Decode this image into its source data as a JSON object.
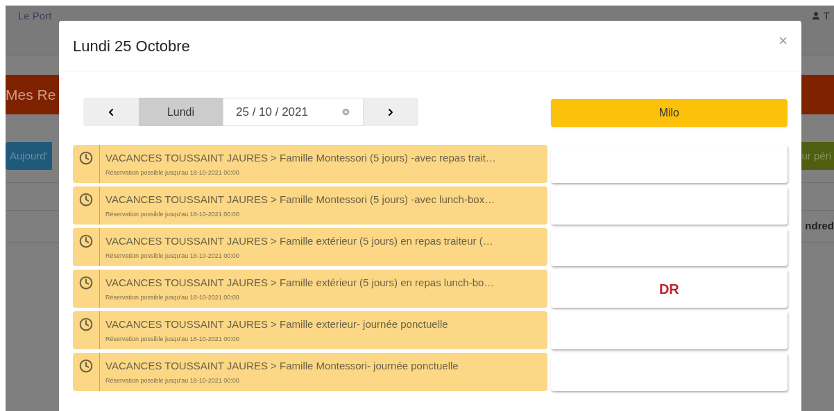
{
  "background": {
    "brand": "Le Port",
    "nav_user": "T",
    "page_title": "Mes Re",
    "today_button": "Aujourd'",
    "period_button": "ur péri",
    "column_header": "ndred"
  },
  "modal": {
    "title": "Lundi 25 Octobre",
    "close": "×",
    "day_label": "Lundi",
    "date_value": "25 / 10 / 2021",
    "child": "Milo",
    "activities": [
      {
        "title": "VACANCES TOUSSAINT JAURES > Famille Montessori (5 jours) -avec repas trait…",
        "subtitle": "Réservation possible jusqu'au 18-10-2021 00:00"
      },
      {
        "title": "VACANCES TOUSSAINT JAURES > Famille Montessori (5 jours) -avec lunch-box…",
        "subtitle": "Réservation possible jusqu'au 18-10-2021 00:00"
      },
      {
        "title": "VACANCES TOUSSAINT JAURES > Famille extérieur (5 jours) en repas traiteur (…",
        "subtitle": "Réservation possible jusqu'au 18-10-2021 00:00"
      },
      {
        "title": "VACANCES TOUSSAINT JAURES > Famille extérieur (5 jours) en repas lunch-bo…",
        "subtitle": "Réservation possible jusqu'au 18-10-2021 00:00",
        "code": "DR"
      },
      {
        "title": "VACANCES TOUSSAINT JAURES > Famille exterieur- journée ponctuelle",
        "subtitle": "Réservation possible jusqu'au 18-10-2021 00:00"
      },
      {
        "title": "VACANCES TOUSSAINT JAURES > Famille Montessori- journée ponctuelle",
        "subtitle": "Réservation possible jusqu'au 18-10-2021 00:00"
      }
    ]
  }
}
